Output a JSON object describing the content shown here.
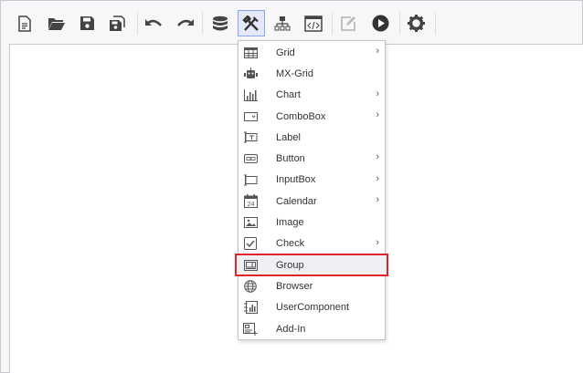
{
  "toolbar": {
    "buttons": [
      "new-document",
      "open-folder",
      "save",
      "save-all",
      "undo",
      "redo",
      "database",
      "tools",
      "hierarchy",
      "html-code",
      "edit",
      "run",
      "settings"
    ]
  },
  "menu": {
    "items": [
      {
        "label": "Grid",
        "icon": "grid-icon",
        "submenu": true
      },
      {
        "label": "MX-Grid",
        "icon": "robot-icon",
        "submenu": false
      },
      {
        "label": "Chart",
        "icon": "chart-icon",
        "submenu": true
      },
      {
        "label": "ComboBox",
        "icon": "combobox-icon",
        "submenu": true
      },
      {
        "label": "Label",
        "icon": "label-icon",
        "submenu": false
      },
      {
        "label": "Button",
        "icon": "button-icon",
        "submenu": true
      },
      {
        "label": "InputBox",
        "icon": "inputbox-icon",
        "submenu": true
      },
      {
        "label": "Calendar",
        "icon": "calendar-icon",
        "submenu": true
      },
      {
        "label": "Image",
        "icon": "image-icon",
        "submenu": false
      },
      {
        "label": "Check",
        "icon": "check-icon",
        "submenu": true
      },
      {
        "label": "Group",
        "icon": "group-icon",
        "submenu": false,
        "highlighted": true
      },
      {
        "label": "Browser",
        "icon": "globe-icon",
        "submenu": false
      },
      {
        "label": "UserComponent",
        "icon": "user-component-icon",
        "submenu": false
      },
      {
        "label": "Add-In",
        "icon": "add-in-icon",
        "submenu": false
      }
    ],
    "arrow": "›",
    "calendar_day": "24",
    "label_glyph": "T"
  },
  "colors": {
    "highlight_border": "#e0242b",
    "active_tool_bg": "#e3e9fb"
  }
}
